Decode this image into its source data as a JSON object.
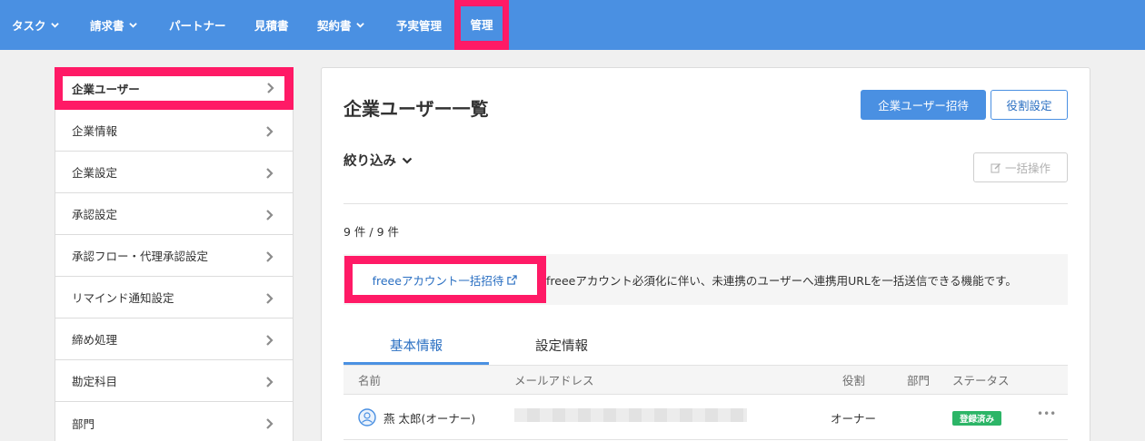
{
  "topnav": {
    "items": [
      {
        "label": "タスク",
        "has_dropdown": true
      },
      {
        "label": "請求書",
        "has_dropdown": true
      },
      {
        "label": "パートナー",
        "has_dropdown": false
      },
      {
        "label": "見積書",
        "has_dropdown": false
      },
      {
        "label": "契約書",
        "has_dropdown": true
      },
      {
        "label": "予実管理",
        "has_dropdown": false
      },
      {
        "label": "管理",
        "has_dropdown": false,
        "active": true
      }
    ],
    "background": "#4a90e2",
    "highlight_color": "#ff1a66"
  },
  "sidebar": {
    "items": [
      {
        "label": "企業ユーザー",
        "active": true
      },
      {
        "label": "企業情報"
      },
      {
        "label": "企業設定"
      },
      {
        "label": "承認設定"
      },
      {
        "label": "承認フロー・代理承認設定"
      },
      {
        "label": "リマインド通知設定"
      },
      {
        "label": "締め処理"
      },
      {
        "label": "勘定科目"
      },
      {
        "label": "部門"
      }
    ]
  },
  "main": {
    "title": "企業ユーザー一覧",
    "invite_button": "企業ユーザー招待",
    "role_button": "役割設定",
    "filter_label": "絞り込み",
    "bulk_button": "一括操作",
    "count": "9 件 / 9 件",
    "notice": {
      "link_label": "freeeアカウント一括招待",
      "text": "freeeアカウント必須化に伴い、未連携のユーザーへ連携用URLを一括送信できる機能です。"
    },
    "tabs": [
      {
        "label": "基本情報",
        "active": true
      },
      {
        "label": "設定情報",
        "active": false
      }
    ],
    "table": {
      "headers": {
        "name": "名前",
        "email": "メールアドレス",
        "role": "役割",
        "dept": "部門",
        "status": "ステータス"
      },
      "rows": [
        {
          "name": "燕 太郎(オーナー)",
          "role": "オーナー",
          "status": "登録済み",
          "more": "•••"
        }
      ]
    },
    "accent": "#4a90e2",
    "status_color": "#2cb567"
  }
}
